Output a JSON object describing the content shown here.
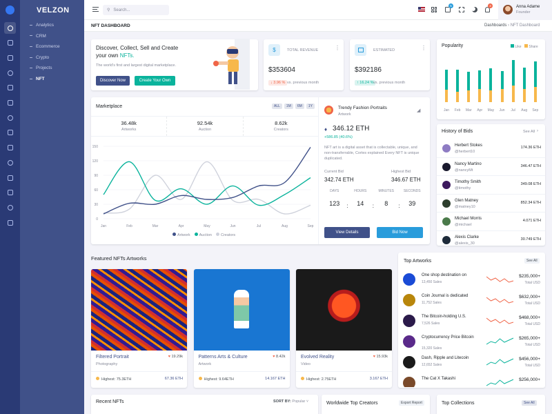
{
  "brand": "VELZON",
  "menu": [
    "Analytics",
    "CRM",
    "Ecommerce",
    "Crypto",
    "Projects",
    "NFT"
  ],
  "search_placeholder": "Search...",
  "user": {
    "name": "Anna Adame",
    "role": "Founder"
  },
  "badges": {
    "cart": "5",
    "notif": "3"
  },
  "page_title": "NFT DASHBOARD",
  "breadcrumb": {
    "root": "Dashboards",
    "current": "NFT Dashboard"
  },
  "hero": {
    "title_1": "Discover, Collect, Sell and Create",
    "title_2": "your own ",
    "title_nft": "NFTs.",
    "subtitle": "The world's first and largest digital marketplace.",
    "btn_discover": "Discover Now",
    "btn_create": "Create Your Own"
  },
  "revenue": {
    "label": "TOTAL REVENUE",
    "value": "$353604",
    "change": "↓ 3.96 %",
    "note": "vs. previous month"
  },
  "estimated": {
    "label": "ESTIMATED",
    "value": "$392186",
    "change": "↑ 16.24 %",
    "note": "vs. previous month"
  },
  "popularity": {
    "title": "Popularity",
    "legend_like": "Like",
    "legend_share": "Share",
    "months": [
      "Jan",
      "Feb",
      "Mar",
      "Apr",
      "May",
      "Jun",
      "Jul",
      "Aug",
      "Sep"
    ],
    "like": [
      0.42,
      0.47,
      0.4,
      0.4,
      0.47,
      0.38,
      0.55,
      0.45,
      0.55
    ],
    "share": [
      0.27,
      0.22,
      0.25,
      0.28,
      0.25,
      0.28,
      0.35,
      0.28,
      0.32
    ]
  },
  "marketplace": {
    "title": "Marketplace",
    "filters": [
      "ALL",
      "1M",
      "6M",
      "1Y"
    ],
    "stats": [
      {
        "value": "36.48k",
        "label": "Artworks"
      },
      {
        "value": "92.54k",
        "label": "Auction"
      },
      {
        "value": "8.62k",
        "label": "Creators"
      }
    ],
    "legend": [
      "Artwork",
      "Auction",
      "Creators"
    ]
  },
  "chart_data": {
    "type": "line",
    "categories": [
      "Jan",
      "Feb",
      "Mar",
      "Apr",
      "May",
      "Jun",
      "Jul",
      "Aug",
      "Sep"
    ],
    "ylim": [
      0,
      150
    ],
    "yticks": [
      "150",
      "120",
      "90",
      "60",
      "30",
      "0"
    ],
    "series": [
      {
        "name": "Artwork",
        "color": "#405189",
        "values": [
          10,
          32,
          30,
          48,
          40,
          44,
          68,
          75,
          148
        ]
      },
      {
        "name": "Auction",
        "color": "#0ab39c",
        "values": [
          50,
          118,
          38,
          62,
          30,
          68,
          28,
          50,
          85
        ]
      },
      {
        "name": "Creators",
        "color": "#cfd2dc",
        "values": [
          12,
          20,
          90,
          40,
          118,
          38,
          40,
          10,
          28
        ]
      }
    ]
  },
  "trendy": {
    "title": "Trendy Fashion Portraits",
    "sub": "Artwork",
    "price": "346.12 ETH",
    "change": "+586.85 (40.6%)",
    "desc": "NFT art is a digital asset that is collectable, unique, and non-transferrable, Cortes explained Every NFT is unique duplicated.",
    "current_bid_label": "Current Bid",
    "current_bid": "342.74 ETH",
    "highest_bid_label": "Highest Bid",
    "highest_bid": "346.67 ETH",
    "timer_labels": [
      "DAYS",
      "HOURS",
      "MINUTES",
      "SECONDS"
    ],
    "timer": [
      "123",
      "14",
      "8",
      "39"
    ],
    "btn_details": "View Details",
    "btn_bid": "Bid Now"
  },
  "bids": {
    "title": "History of Bids",
    "see_all": "See All",
    "rows": [
      {
        "name": "Herbert Stokes",
        "handle": "@herbert10",
        "value": "174.36 ETH"
      },
      {
        "name": "Nancy Martino",
        "handle": "@nancyMt",
        "value": "346.47 ETH"
      },
      {
        "name": "Timothy Smith",
        "handle": "@timothy",
        "value": "349.08 ETH"
      },
      {
        "name": "Glen Matney",
        "handle": "@matney10",
        "value": "852.34 ETH"
      },
      {
        "name": "Michael Morris",
        "handle": "@michael",
        "value": "4.071 ETH"
      },
      {
        "name": "Alexis Clarke",
        "handle": "@alexis_30",
        "value": "30.749 ETH"
      }
    ]
  },
  "featured": {
    "title": "Featured NFTs Artworks",
    "items": [
      {
        "name": "Filtered Portrait",
        "cat": "Photography",
        "likes": "19.29k",
        "highest": "Highest: 75.3ETH",
        "eth": "67.36 ETH"
      },
      {
        "name": "Patterns Arts & Culture",
        "cat": "Artwork",
        "likes": "8.42k",
        "highest": "Highest: 9.64ETH",
        "eth": "14.167 ETH"
      },
      {
        "name": "Evolved Reality",
        "cat": "Video",
        "likes": "15.93k",
        "highest": "Highest: 2.75ETH",
        "eth": "3.167 ETH"
      }
    ]
  },
  "top_artworks": {
    "title": "Top Artworks",
    "see_all": "See All",
    "rows": [
      {
        "name": "One shop destination on",
        "sales": "13,450 Sales",
        "price": "$235,000+",
        "label": "Total USD",
        "trend": "down"
      },
      {
        "name": "Coin Journal is dedicated",
        "sales": "11,752 Sales",
        "price": "$632,000+",
        "label": "Total USD",
        "trend": "down"
      },
      {
        "name": "The Bitcoin-holding U.S.",
        "sales": "7,526 Sales",
        "price": "$468,000+",
        "label": "Total USD",
        "trend": "down"
      },
      {
        "name": "Cryptocurrency Price Bitcoin",
        "sales": "15,320 Sales",
        "price": "$265,000+",
        "label": "Total USD",
        "trend": "up"
      },
      {
        "name": "Dash, Ripple and Litecoin",
        "sales": "12,652 Sales",
        "price": "$456,000+",
        "label": "Total USD",
        "trend": "up"
      },
      {
        "name": "The Cat X Takashi",
        "sales": "",
        "price": "$256,000+",
        "label": "",
        "trend": "up"
      }
    ]
  },
  "recent": {
    "title": "Recent NFTs",
    "sort_label": "SORT BY:",
    "sort_value": "Popular"
  },
  "creators": {
    "title": "Worldwide Top Creators",
    "btn": "Export Report"
  },
  "collections": {
    "title": "Top Collections",
    "see_all": "See All"
  }
}
